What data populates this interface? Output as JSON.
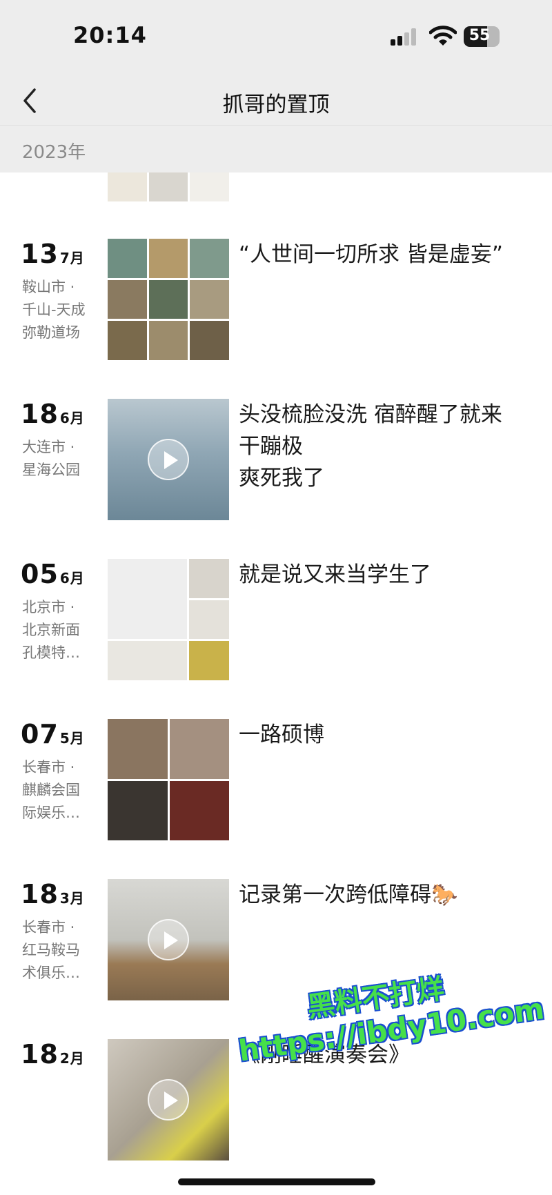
{
  "status_bar": {
    "time": "20:14",
    "battery": "55"
  },
  "nav": {
    "title": "抓哥的置顶",
    "back_icon": "chevron-left-icon"
  },
  "year": "2023年",
  "posts": [
    {
      "day": "13",
      "month": "7月",
      "location": [
        "鞍山市 ·",
        "千山-天成",
        "弥勒道场"
      ],
      "caption": "“人世间一切所求 皆是虚妄”",
      "media": "9 photos"
    },
    {
      "day": "18",
      "month": "6月",
      "location": [
        "大连市 ·",
        "星海公园"
      ],
      "caption": "头没梳脸没洗 宿醉醒了就来\n干蹦极\n爽死我了",
      "media": "video"
    },
    {
      "day": "05",
      "month": "6月",
      "location": [
        "北京市 ·",
        "北京新面",
        "孔模特…"
      ],
      "caption": "就是说又来当学生了",
      "media": "6 photos"
    },
    {
      "day": "07",
      "month": "5月",
      "location": [
        "长春市 ·",
        "麒麟会国",
        "际娱乐…"
      ],
      "caption": "一路硕博",
      "media": "4 photos"
    },
    {
      "day": "18",
      "month": "3月",
      "location": [
        "长春市 ·",
        "红马鞍马",
        "术俱乐…"
      ],
      "caption": "记录第一次跨低障碍🐎",
      "media": "video"
    },
    {
      "day": "18",
      "month": "2月",
      "location": [],
      "caption": "《刚睡醒演奏会》",
      "media": "video"
    }
  ],
  "watermark": {
    "line1": "黑料不打烊",
    "line2": "https://ibdy10.com"
  },
  "colors": {
    "nav_bg": "#ededed",
    "watermark_fill": "#46e04a",
    "watermark_outline": "#1a4fd0"
  }
}
